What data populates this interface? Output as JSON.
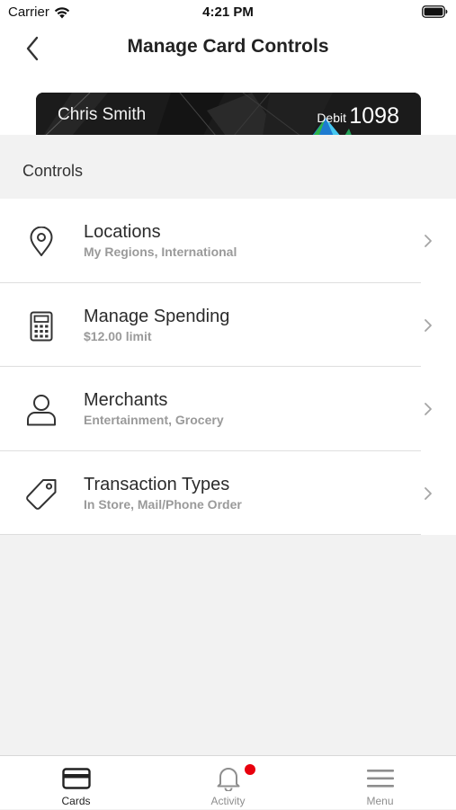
{
  "status_bar": {
    "carrier": "Carrier",
    "time": "4:21 PM"
  },
  "nav": {
    "title": "Manage Card Controls",
    "back_icon": "chevron-left-icon"
  },
  "card": {
    "holder_name": "Chris Smith",
    "type": "Debit",
    "last4": "1098"
  },
  "controls": {
    "header": "Controls",
    "items": [
      {
        "title": "Locations",
        "subtitle": "My Regions, International",
        "icon": "location-pin-icon"
      },
      {
        "title": "Manage Spending",
        "subtitle": "$12.00 limit",
        "icon": "calculator-icon"
      },
      {
        "title": "Merchants",
        "subtitle": "Entertainment, Grocery",
        "icon": "person-icon"
      },
      {
        "title": "Transaction Types",
        "subtitle": "In Store, Mail/Phone Order",
        "icon": "tag-icon"
      }
    ]
  },
  "tab_bar": {
    "tabs": [
      {
        "label": "Cards",
        "icon": "card-icon",
        "active": true
      },
      {
        "label": "Activity",
        "icon": "bell-icon",
        "active": false,
        "badge": true
      },
      {
        "label": "Menu",
        "icon": "hamburger-icon",
        "active": false
      }
    ]
  },
  "colors": {
    "accent": "#e8000d",
    "active_tab": "#222222",
    "inactive_tab": "#8e8e8e"
  }
}
